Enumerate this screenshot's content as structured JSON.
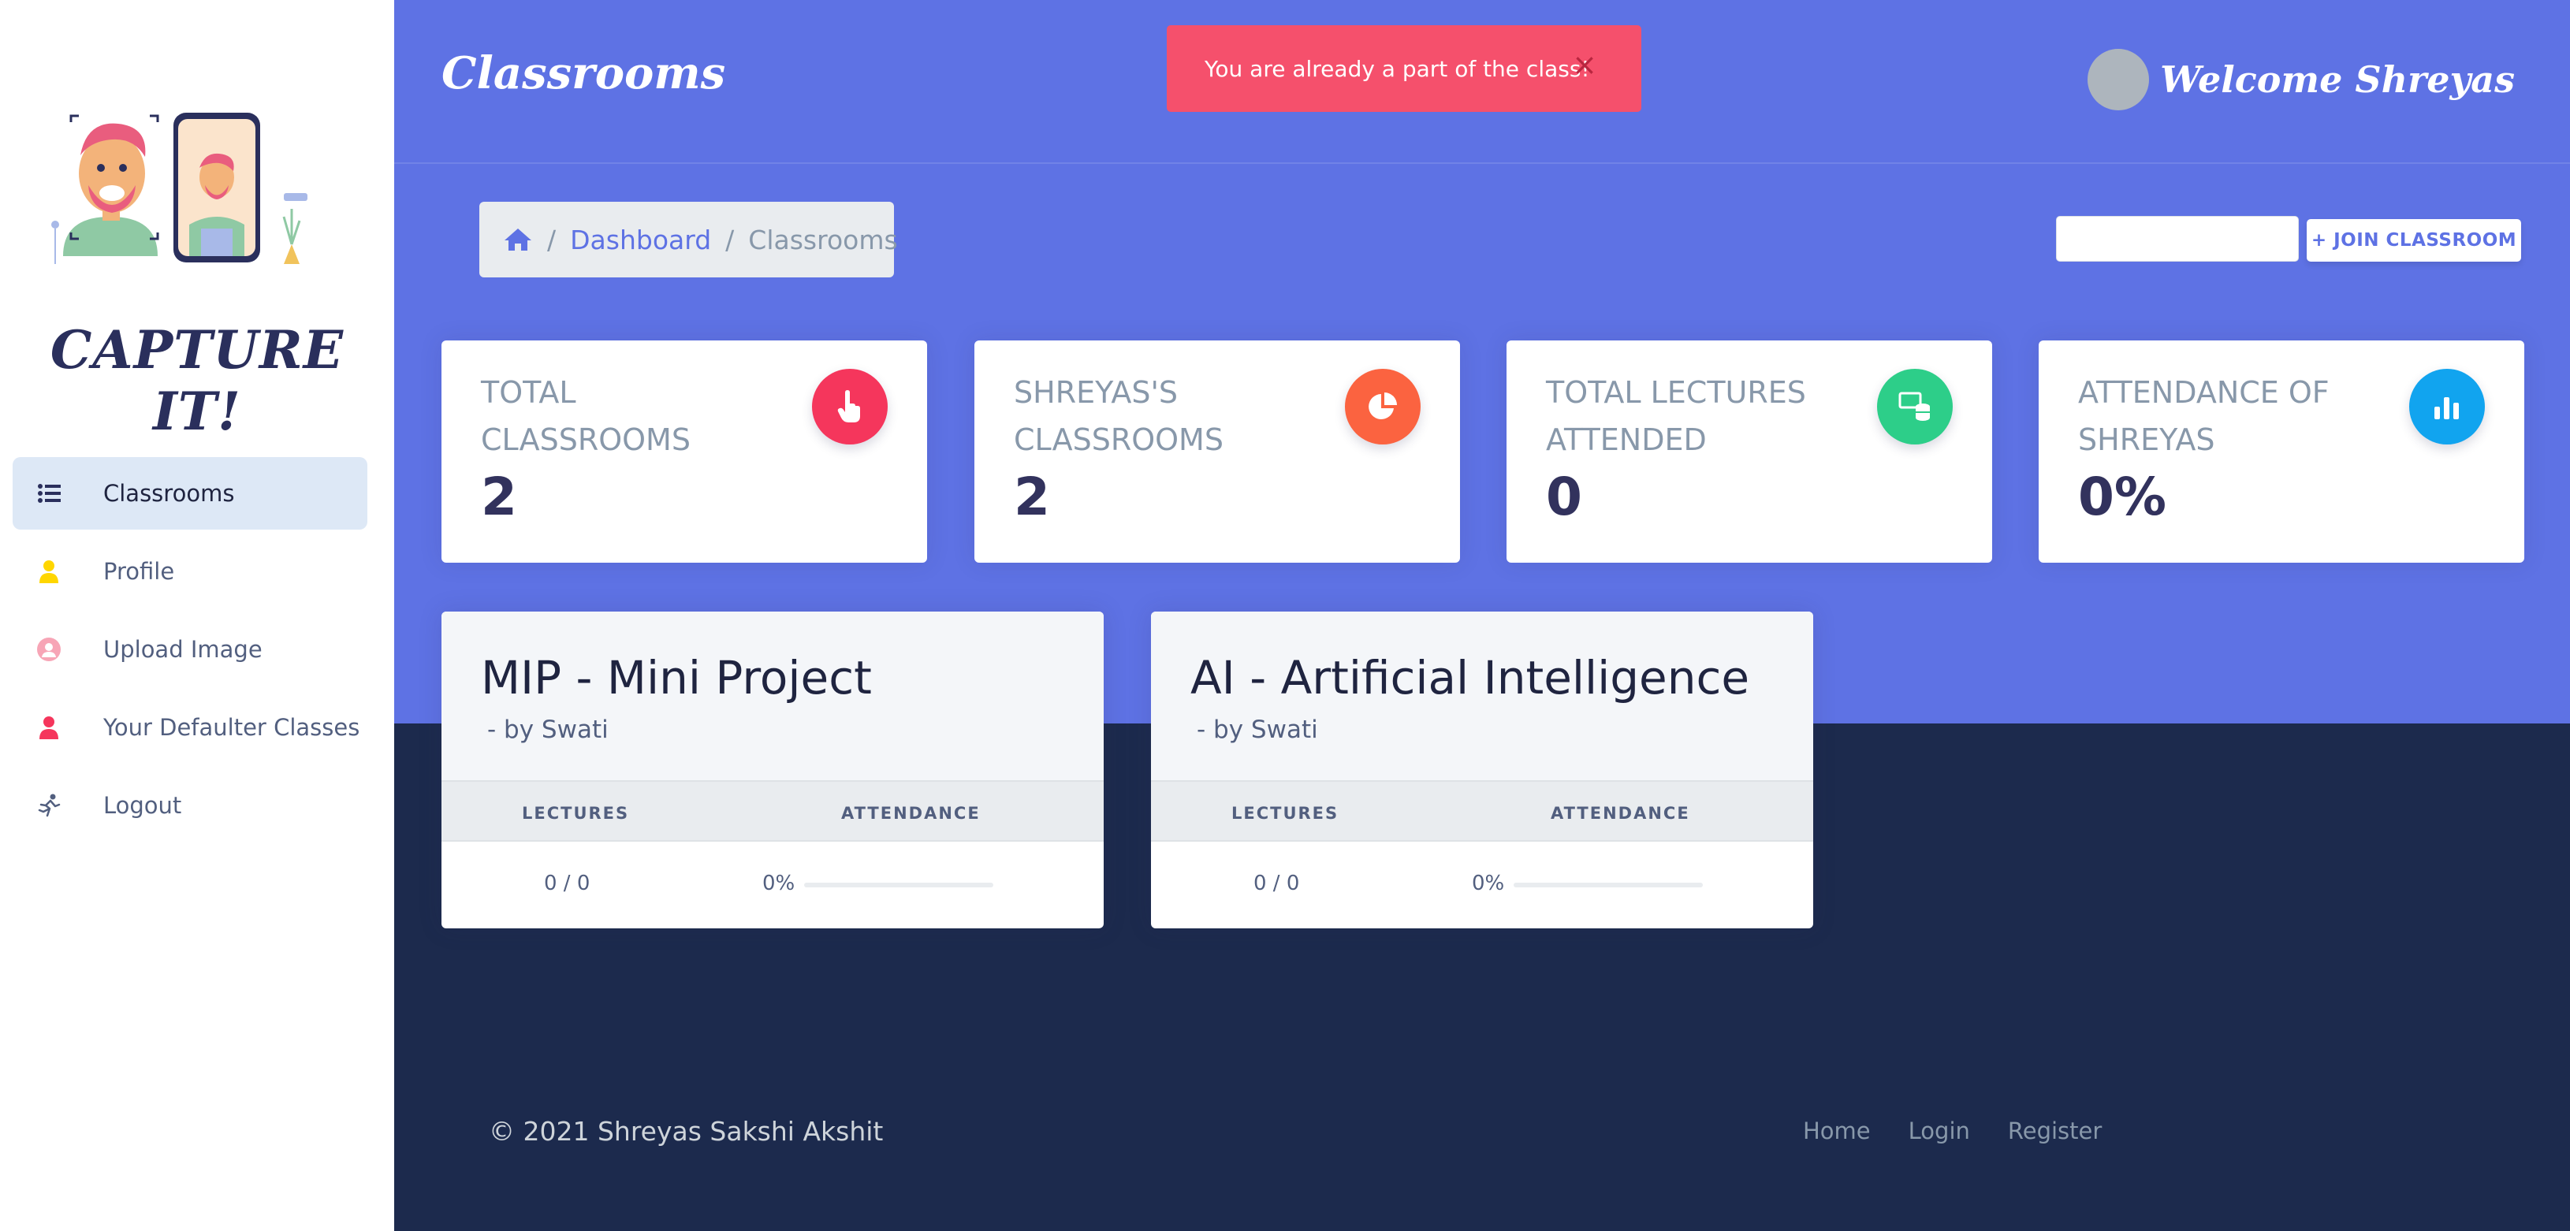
{
  "app": {
    "brand": "CAPTURE IT!",
    "page_title": "Classrooms",
    "welcome": "Welcome Shreyas"
  },
  "sidebar": {
    "items": [
      {
        "label": "Classrooms",
        "icon": "list-icon",
        "active": true
      },
      {
        "label": "Profile",
        "icon": "user-icon"
      },
      {
        "label": "Upload Image",
        "icon": "user-circle-icon"
      },
      {
        "label": "Your Defaulter Classes",
        "icon": "user-icon"
      },
      {
        "label": "Logout",
        "icon": "running-person-icon"
      }
    ]
  },
  "toast": {
    "message": "You are already a part of the class!",
    "close": "×"
  },
  "breadcrumb": {
    "home_icon": "home-icon",
    "sep1": "/",
    "dashboard": "Dashboard",
    "sep2": "/",
    "current": "Classrooms"
  },
  "join": {
    "value": "",
    "button": "+ JOIN CLASSROOM"
  },
  "stats": [
    {
      "title": "TOTAL CLASSROOMS",
      "value": "2",
      "icon": "hand-pointer-icon",
      "color": "#f5365c"
    },
    {
      "title": "SHREYAS'S CLASSROOMS",
      "value": "2",
      "icon": "pie-chart-icon",
      "color": "#fb6340"
    },
    {
      "title": "TOTAL LECTURES ATTENDED",
      "value": "0",
      "icon": "database-icon",
      "color": "#2dce89"
    },
    {
      "title": "ATTENDANCE OF SHREYAS",
      "value": "0%",
      "icon": "bar-chart-icon",
      "color": "#11cdef"
    }
  ],
  "classes": [
    {
      "name": "MIP - Mini Project",
      "by": "- by Swati",
      "col_lectures": "LECTURES",
      "col_attendance": "ATTENDANCE",
      "lectures": "0 / 0",
      "attendance": "0%",
      "attendance_fraction": 0
    },
    {
      "name": "AI - Artificial Intelligence",
      "by": "- by Swati",
      "col_lectures": "LECTURES",
      "col_attendance": "ATTENDANCE",
      "lectures": "0 / 0",
      "attendance": "0%",
      "attendance_fraction": 0
    }
  ],
  "footer": {
    "copyright": "© 2021 Shreyas Sakshi Akshit",
    "links": [
      "Home",
      "Login",
      "Register"
    ]
  }
}
